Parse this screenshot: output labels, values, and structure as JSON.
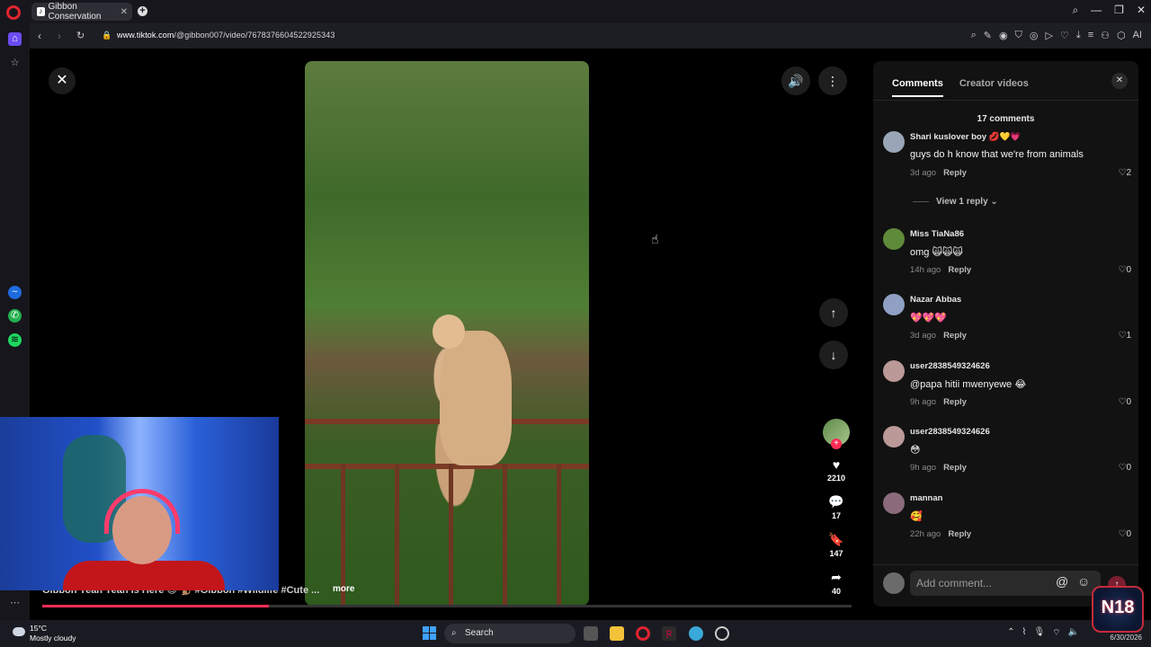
{
  "browser": {
    "tab_title": "Gibbon Conservation",
    "url_host": "www.tiktok.com",
    "url_path": "/@gibbon007/video/7678376604522925343",
    "ai_label": "AI"
  },
  "video": {
    "caption": "Gibbon Yeah Yeah is Here 😍 🐒 #Gibbon #Wildlife #Cute ...",
    "more_label": "more",
    "progress_percent": 28
  },
  "actions": {
    "likes": "2210",
    "comments": "17",
    "saves": "147",
    "shares": "40"
  },
  "panel": {
    "tabs": [
      {
        "label": "Comments",
        "active": true
      },
      {
        "label": "Creator videos",
        "active": false
      }
    ],
    "comment_count": "17 comments",
    "view_reply": "View 1 reply",
    "add_placeholder": "Add comment...",
    "comments": [
      {
        "user": "Shari kuslover boy 💋💛💗",
        "text": "guys do h know that we're from animals",
        "time": "3d ago",
        "reply": "Reply",
        "likes": "2",
        "avatar_color": "#9aa6b8"
      },
      {
        "user": "Miss TiaNa86",
        "text": "omg 🙀🙀🙀",
        "time": "14h ago",
        "reply": "Reply",
        "likes": "0",
        "avatar_color": "#5f8a3a"
      },
      {
        "user": "Nazar Abbas",
        "text": "💖💖💖",
        "time": "3d ago",
        "reply": "Reply",
        "likes": "1",
        "avatar_color": "#8fa0c4"
      },
      {
        "user": "user2838549324626",
        "text": "@papa hitii mwenyewe 😂",
        "time": "9h ago",
        "reply": "Reply",
        "likes": "0",
        "avatar_color": "#b99"
      },
      {
        "user": "user2838549324626",
        "text": "😳",
        "time": "9h ago",
        "reply": "Reply",
        "likes": "0",
        "avatar_color": "#b99"
      },
      {
        "user": "mannan",
        "text": "🥰",
        "time": "22h ago",
        "reply": "Reply",
        "likes": "0",
        "avatar_color": "#8b6b7b"
      }
    ]
  },
  "taskbar": {
    "temp": "15°C",
    "weather": "Mostly cloudy",
    "search_label": "Search",
    "date": "6/30/2026"
  },
  "badge": "N18",
  "colors": {
    "accent": "#fe2c55",
    "panel_bg": "#121212"
  }
}
